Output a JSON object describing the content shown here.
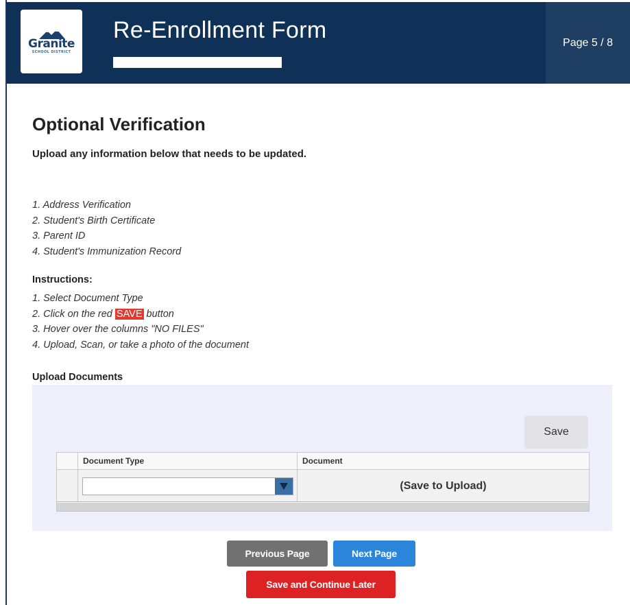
{
  "header": {
    "logo": {
      "word": "Granite",
      "subtext": "SCHOOL DISTRICT"
    },
    "title": "Re-Enrollment Form",
    "page_indicator": "Page 5 / 8"
  },
  "section": {
    "title": "Optional Verification",
    "subtitle": "Upload any information below that needs to be updated."
  },
  "documents_list": [
    "1. Address Verification",
    "2. Student's Birth Certificate",
    "3. Parent ID",
    "4. Student's Immunization Record"
  ],
  "instructions": {
    "heading": "Instructions:",
    "item1": "1. Select Document Type",
    "item2_before": "2. Click on the red ",
    "item2_highlight": "SAVE",
    "item2_after": " button",
    "item3": "3. Hover over the columns \"NO FILES\"",
    "item4": "4. Upload, Scan, or take a photo of the document"
  },
  "upload": {
    "heading": "Upload Documents",
    "save_label": "Save",
    "columns": [
      "Document Type",
      "Document"
    ],
    "document_type_value": "",
    "document_cell": "(Save to Upload)"
  },
  "buttons": {
    "previous": "Previous Page",
    "next": "Next Page",
    "save_later": "Save and Continue Later"
  },
  "colors": {
    "header_bg": "#0f3057",
    "next_button": "#2b86db",
    "save_later_button": "#dc2223",
    "previous_button": "#717171",
    "save_highlight": "#e23a2e"
  }
}
